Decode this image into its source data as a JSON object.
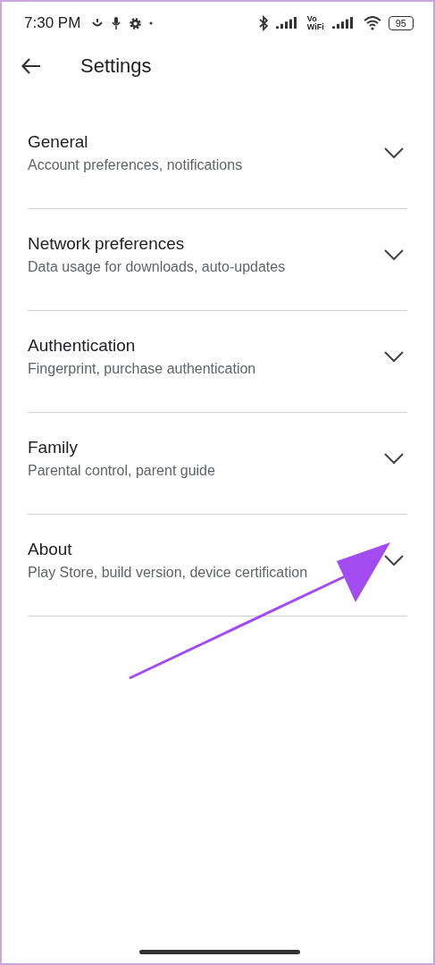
{
  "status_bar": {
    "time": "7:30 PM",
    "volte": [
      "Vo",
      "WiFi"
    ],
    "battery": "95"
  },
  "header": {
    "title": "Settings"
  },
  "sections": [
    {
      "title": "General",
      "subtitle": "Account preferences, notifications",
      "expanded": false
    },
    {
      "title": "Network preferences",
      "subtitle": "Data usage for downloads, auto-updates",
      "expanded": false
    },
    {
      "title": "Authentication",
      "subtitle": "Fingerprint, purchase authentication",
      "expanded": false
    },
    {
      "title": "Family",
      "subtitle": "Parental control, parent guide",
      "expanded": false
    },
    {
      "title": "About",
      "subtitle": "Play Store, build version, device certification",
      "expanded": false
    }
  ]
}
